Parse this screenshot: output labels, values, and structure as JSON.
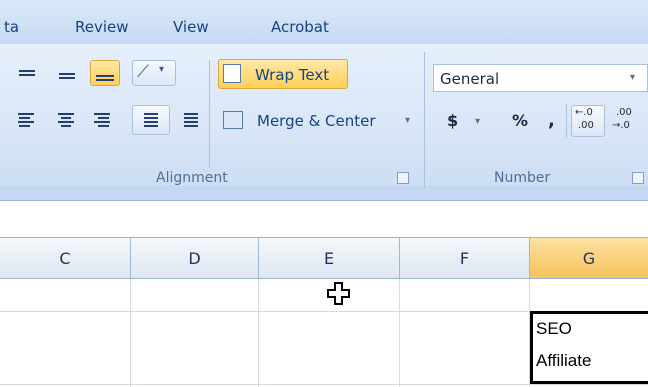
{
  "tabs": [
    "ta",
    "Review",
    "View",
    "Acrobat"
  ],
  "alignment": {
    "wrap_text": "Wrap Text",
    "merge_center": "Merge & Center",
    "merge_arrow": "▾",
    "group_label": "Alignment",
    "orientation_arrow": "▾"
  },
  "number": {
    "format_value": "General",
    "format_arrow": "▾",
    "currency": "$",
    "currency_arrow": "▾",
    "percent": "%",
    "comma": ",",
    "inc_decimal_top": "←.0",
    "inc_decimal_bottom": ".00",
    "dec_decimal_top": ".00",
    "dec_decimal_bottom": "→.0",
    "group_label": "Number"
  },
  "columns": [
    "C",
    "D",
    "E",
    "F",
    "G"
  ],
  "selected_column": "G",
  "cells": {
    "g_row2_line1": "SEO",
    "g_row2_line2": "Affiliate"
  },
  "colors": {
    "accent_selected": "#f6c35b",
    "ribbon": "#d9e6f7",
    "tab_text": "#15428b"
  }
}
